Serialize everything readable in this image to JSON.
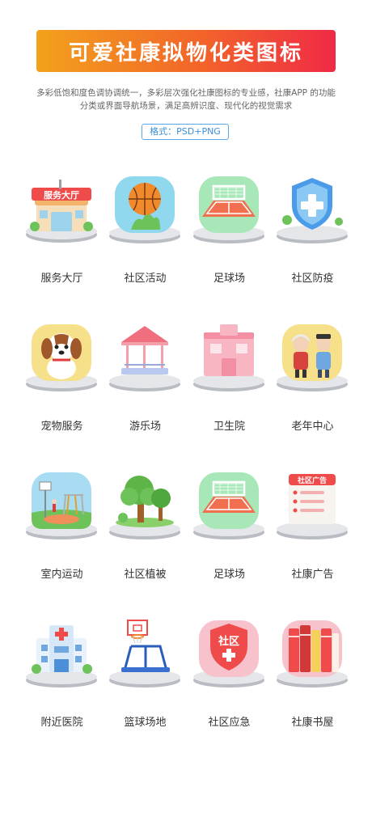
{
  "banner": {
    "title": "可爱社康拟物化类图标"
  },
  "description": {
    "line1": "多彩低饱和度色调协调统一，多彩层次强化社康图标的专业感，社康APP 的功能",
    "line2": "分类或界面导航场景，满足高辨识度、现代化的视觉需求"
  },
  "format_tag": "格式：PSD+PNG",
  "icons": [
    {
      "label": "服务大厅",
      "icon": "service-hall-icon",
      "sign": "服务大厅"
    },
    {
      "label": "社区活动",
      "icon": "basketball-icon"
    },
    {
      "label": "足球场",
      "icon": "football-field-icon"
    },
    {
      "label": "社区防疫",
      "icon": "shield-cross-icon"
    },
    {
      "label": "宠物服务",
      "icon": "puppy-icon"
    },
    {
      "label": "游乐场",
      "icon": "pavilion-icon"
    },
    {
      "label": "卫生院",
      "icon": "clinic-building-icon"
    },
    {
      "label": "老年中心",
      "icon": "elderly-couple-icon"
    },
    {
      "label": "室内运动",
      "icon": "playground-icon"
    },
    {
      "label": "社区植被",
      "icon": "trees-icon"
    },
    {
      "label": "足球场",
      "icon": "football-field-icon"
    },
    {
      "label": "社康广告",
      "icon": "notice-board-icon",
      "sign": "社区广告"
    },
    {
      "label": "附近医院",
      "icon": "hospital-icon"
    },
    {
      "label": "篮球场地",
      "icon": "basketball-hoop-icon"
    },
    {
      "label": "社区应急",
      "icon": "emergency-shield-icon",
      "sign": "社区"
    },
    {
      "label": "社康书屋",
      "icon": "books-icon"
    }
  ],
  "colors": {
    "banner_start": "#f3a21c",
    "banner_end": "#ef2a45",
    "format_border": "#5aa7e8"
  }
}
